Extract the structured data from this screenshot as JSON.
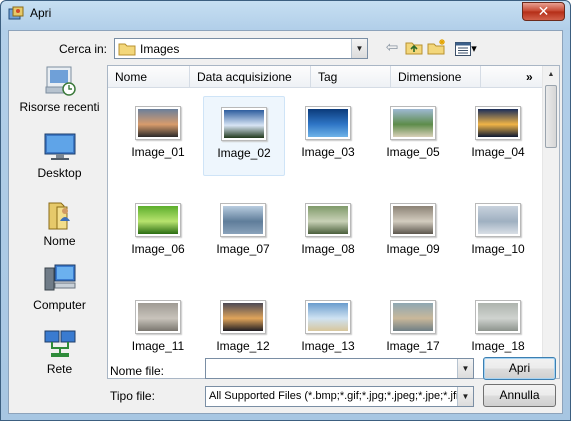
{
  "window": {
    "title": "Apri",
    "close_glyph": "✕"
  },
  "lookin": {
    "label": "Cerca in:",
    "value": "Images"
  },
  "toolbar": {
    "back_glyph": "⇦",
    "view_menu_glyph": "▾"
  },
  "places": [
    {
      "name": "recent",
      "label": "Risorse recenti"
    },
    {
      "name": "desktop",
      "label": "Desktop"
    },
    {
      "name": "user",
      "label": "Nome"
    },
    {
      "name": "computer",
      "label": "Computer"
    },
    {
      "name": "network",
      "label": "Rete"
    }
  ],
  "columns": [
    "Nome",
    "Data acquisizione",
    "Tag",
    "Dimensione"
  ],
  "more_columns_glyph": "»",
  "items": [
    {
      "name": "Image_01",
      "colors": [
        "#6b7f9a",
        "#d89c6c",
        "#2b2a2a"
      ]
    },
    {
      "name": "Image_02",
      "colors": [
        "#2e5d9e",
        "#d7e4f4",
        "#223a1d"
      ]
    },
    {
      "name": "Image_03",
      "colors": [
        "#0b3a7a",
        "#2f76c6",
        "#6fb3e8"
      ]
    },
    {
      "name": "Image_05",
      "colors": [
        "#9fb9d4",
        "#5d8c4a",
        "#d9d0b8"
      ]
    },
    {
      "name": "Image_04",
      "colors": [
        "#1b2e5a",
        "#f0b447",
        "#0e1a33"
      ]
    },
    {
      "name": "Image_06",
      "colors": [
        "#5cae2c",
        "#b7e36e",
        "#2a6d12"
      ]
    },
    {
      "name": "Image_07",
      "colors": [
        "#b9cde0",
        "#5f7d9a",
        "#8aa3bb"
      ]
    },
    {
      "name": "Image_08",
      "colors": [
        "#7f9a6a",
        "#c8d1b6",
        "#4a5f3b"
      ]
    },
    {
      "name": "Image_09",
      "colors": [
        "#8b8275",
        "#d3ccbf",
        "#5c564d"
      ]
    },
    {
      "name": "Image_10",
      "colors": [
        "#c8d2dd",
        "#9fb0c1",
        "#d9dfe6"
      ]
    },
    {
      "name": "Image_11",
      "colors": [
        "#9f9b94",
        "#c8c3bb",
        "#7a766f"
      ]
    },
    {
      "name": "Image_12",
      "colors": [
        "#4d4a55",
        "#e0a45a",
        "#1f1d23"
      ]
    },
    {
      "name": "Image_13",
      "colors": [
        "#6a9ccd",
        "#cfe2f2",
        "#d8c79c"
      ]
    },
    {
      "name": "Image_17",
      "colors": [
        "#8fa7b3",
        "#c9b89a",
        "#6f7f85"
      ]
    },
    {
      "name": "Image_18",
      "colors": [
        "#aeb4ae",
        "#cfd3cf",
        "#8d948d"
      ]
    }
  ],
  "selected_item": "Image_02",
  "filename": {
    "label": "Nome file:",
    "value": ""
  },
  "filetype": {
    "label": "Tipo file:",
    "value": "All Supported Files (*.bmp;*.gif;*.jpg;*.jpeg;*.jpe;*.jfif;*.png;*.tif;*.tiff)"
  },
  "buttons": {
    "open": "Apri",
    "cancel": "Annulla"
  }
}
